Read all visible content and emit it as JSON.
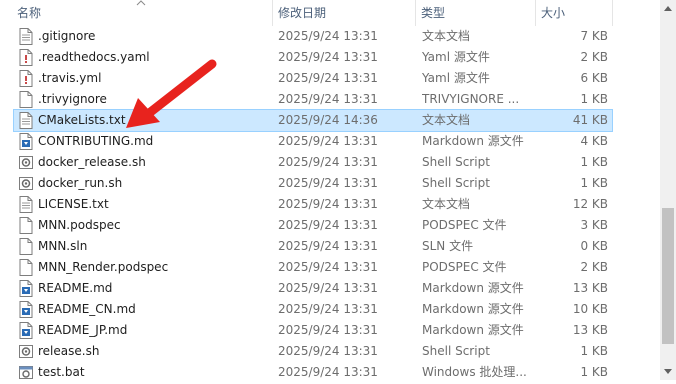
{
  "columns": {
    "name": "名称",
    "date": "修改日期",
    "type": "类型",
    "size": "大小"
  },
  "files": [
    {
      "name": ".gitignore",
      "date": "2025/9/24 13:31",
      "type": "文本文档",
      "size": "7 KB",
      "icon": "text-file-icon"
    },
    {
      "name": ".readthedocs.yaml",
      "date": "2025/9/24 13:31",
      "type": "Yaml 源文件",
      "size": "2 KB",
      "icon": "yaml-file-icon"
    },
    {
      "name": ".travis.yml",
      "date": "2025/9/24 13:31",
      "type": "Yaml 源文件",
      "size": "6 KB",
      "icon": "yaml-file-icon"
    },
    {
      "name": ".trivyignore",
      "date": "2025/9/24 13:31",
      "type": "TRIVYIGNORE ...",
      "size": "1 KB",
      "icon": "blank-file-icon"
    },
    {
      "name": "CMakeLists.txt",
      "date": "2025/9/24 14:36",
      "type": "文本文档",
      "size": "41 KB",
      "icon": "text-file-icon",
      "selected": true
    },
    {
      "name": "CONTRIBUTING.md",
      "date": "2025/9/24 13:31",
      "type": "Markdown 源文件",
      "size": "4 KB",
      "icon": "markdown-file-icon"
    },
    {
      "name": "docker_release.sh",
      "date": "2025/9/24 13:31",
      "type": "Shell Script",
      "size": "1 KB",
      "icon": "shell-script-icon"
    },
    {
      "name": "docker_run.sh",
      "date": "2025/9/24 13:31",
      "type": "Shell Script",
      "size": "1 KB",
      "icon": "shell-script-icon"
    },
    {
      "name": "LICENSE.txt",
      "date": "2025/9/24 13:31",
      "type": "文本文档",
      "size": "12 KB",
      "icon": "text-file-icon"
    },
    {
      "name": "MNN.podspec",
      "date": "2025/9/24 13:31",
      "type": "PODSPEC 文件",
      "size": "3 KB",
      "icon": "blank-file-icon"
    },
    {
      "name": "MNN.sln",
      "date": "2025/9/24 13:31",
      "type": "SLN 文件",
      "size": "0 KB",
      "icon": "blank-file-icon"
    },
    {
      "name": "MNN_Render.podspec",
      "date": "2025/9/24 13:31",
      "type": "PODSPEC 文件",
      "size": "2 KB",
      "icon": "blank-file-icon"
    },
    {
      "name": "README.md",
      "date": "2025/9/24 13:31",
      "type": "Markdown 源文件",
      "size": "13 KB",
      "icon": "markdown-file-icon"
    },
    {
      "name": "README_CN.md",
      "date": "2025/9/24 13:31",
      "type": "Markdown 源文件",
      "size": "10 KB",
      "icon": "markdown-file-icon"
    },
    {
      "name": "README_JP.md",
      "date": "2025/9/24 13:31",
      "type": "Markdown 源文件",
      "size": "13 KB",
      "icon": "markdown-file-icon"
    },
    {
      "name": "release.sh",
      "date": "2025/9/24 13:31",
      "type": "Shell Script",
      "size": "1 KB",
      "icon": "shell-script-icon"
    },
    {
      "name": "test.bat",
      "date": "2025/9/24 13:31",
      "type": "Windows 批处理...",
      "size": "1 KB",
      "icon": "batch-file-icon"
    }
  ],
  "colors": {
    "selection_bg": "#cce8ff",
    "selection_border": "#99d1ff",
    "annotation_arrow": "#e8231e",
    "markdown_icon": "#2a6bb5"
  }
}
